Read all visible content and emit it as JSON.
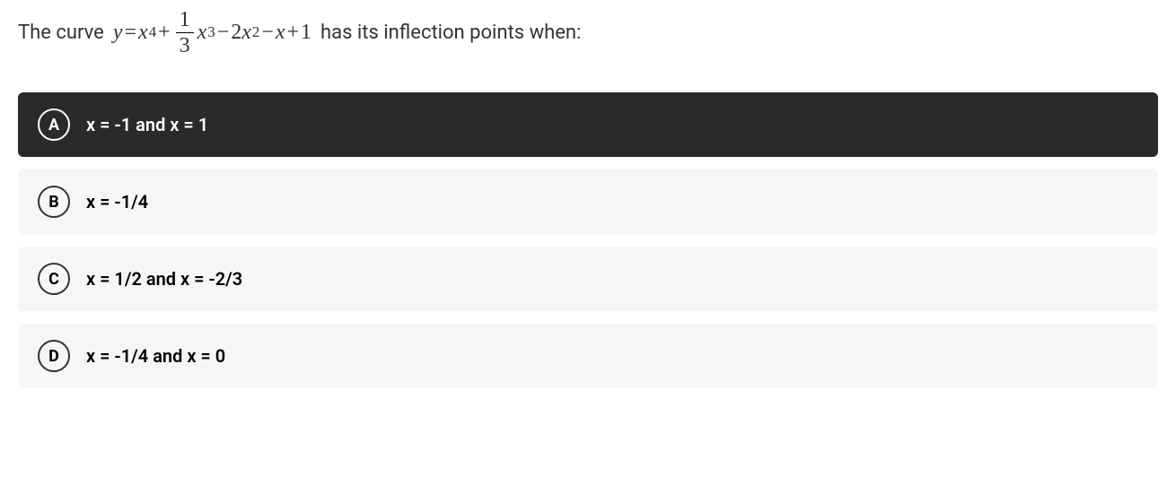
{
  "question": {
    "prefix": "The curve",
    "equation_display": "y = x^4 + (1/3)x^3 - 2x^2 - x + 1",
    "suffix": "has its inflection points when:",
    "frac_top": "1",
    "frac_bot": "3"
  },
  "options": [
    {
      "letter": "A",
      "text": "x = -1 and x = 1",
      "selected": true
    },
    {
      "letter": "B",
      "text": "x = -1/4",
      "selected": false
    },
    {
      "letter": "C",
      "text": "x = 1/2 and x = -2/3",
      "selected": false
    },
    {
      "letter": "D",
      "text": "x = -1/4 and x = 0",
      "selected": false
    }
  ]
}
